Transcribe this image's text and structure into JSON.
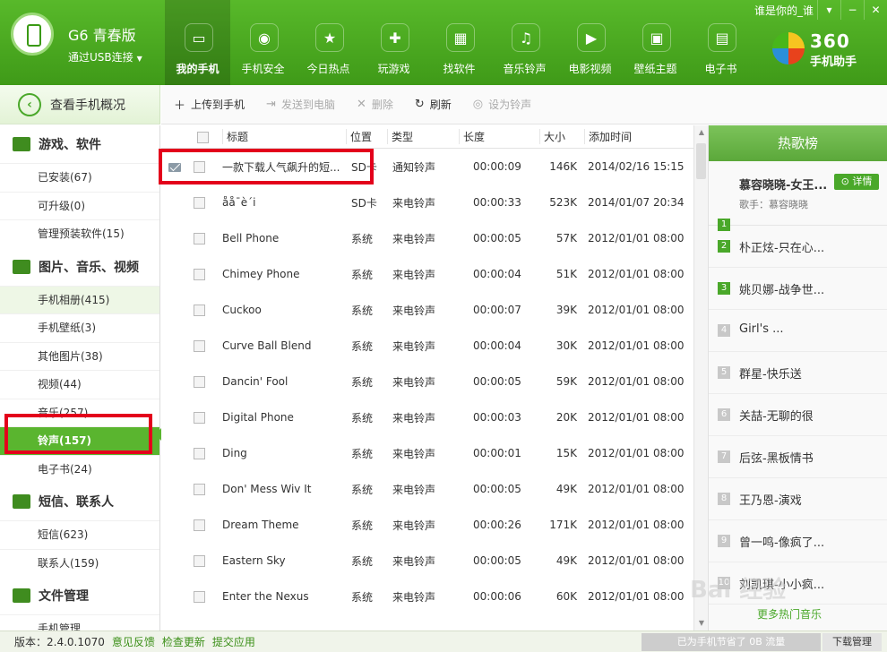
{
  "header": {
    "device_name": "G6 青春版",
    "connection": "通过USB连接",
    "user_label": "谁是你的_谁",
    "brand_num": "360",
    "brand_sub": "手机助手"
  },
  "nav": [
    {
      "label": "我的手机",
      "icon": "phone-icon",
      "glyph": "▭"
    },
    {
      "label": "手机安全",
      "icon": "shield-icon",
      "glyph": "◉"
    },
    {
      "label": "今日热点",
      "icon": "star-news-icon",
      "glyph": "★"
    },
    {
      "label": "玩游戏",
      "icon": "gamepad-icon",
      "glyph": "✚"
    },
    {
      "label": "找软件",
      "icon": "bag-icon",
      "glyph": "▦"
    },
    {
      "label": "音乐铃声",
      "icon": "music-icon",
      "glyph": "♫"
    },
    {
      "label": "电影视频",
      "icon": "film-icon",
      "glyph": "▶"
    },
    {
      "label": "壁纸主题",
      "icon": "picture-icon",
      "glyph": "▣"
    },
    {
      "label": "电子书",
      "icon": "book-icon",
      "glyph": "▤"
    }
  ],
  "overview": {
    "label": "查看手机概况"
  },
  "toolbar": {
    "upload": "上传到手机",
    "send": "发送到电脑",
    "delete": "删除",
    "refresh": "刷新",
    "set_ring": "设为铃声"
  },
  "sidebar": {
    "groups": [
      {
        "title": "游戏、软件",
        "items": [
          "已安装(67)",
          "可升级(0)",
          "管理预装软件(15)"
        ]
      },
      {
        "title": "图片、音乐、视频",
        "items": [
          "手机相册(415)",
          "手机壁纸(3)",
          "其他图片(38)",
          "视频(44)",
          "音乐(257)",
          "铃声(157)",
          "电子书(24)"
        ]
      },
      {
        "title": "短信、联系人",
        "items": [
          "短信(623)",
          "联系人(159)"
        ]
      },
      {
        "title": "文件管理",
        "items": [
          "手机管理"
        ]
      }
    ]
  },
  "table": {
    "headers": [
      "标题",
      "位置",
      "类型",
      "长度",
      "大小",
      "添加时间"
    ],
    "rows": [
      [
        "一款下载人气飙升的短...",
        "SD卡",
        "通知铃声",
        "00:00:09",
        "146K",
        "2014/02/16 15:15"
      ],
      [
        "åå¯è´i",
        "SD卡",
        "来电铃声",
        "00:00:33",
        "523K",
        "2014/01/07 20:34"
      ],
      [
        "Bell Phone",
        "系统",
        "来电铃声",
        "00:00:05",
        "57K",
        "2012/01/01 08:00"
      ],
      [
        "Chimey Phone",
        "系统",
        "来电铃声",
        "00:00:04",
        "51K",
        "2012/01/01 08:00"
      ],
      [
        "Cuckoo",
        "系统",
        "来电铃声",
        "00:00:07",
        "39K",
        "2012/01/01 08:00"
      ],
      [
        "Curve Ball Blend",
        "系统",
        "来电铃声",
        "00:00:04",
        "30K",
        "2012/01/01 08:00"
      ],
      [
        "Dancin' Fool",
        "系统",
        "来电铃声",
        "00:00:05",
        "59K",
        "2012/01/01 08:00"
      ],
      [
        "Digital Phone",
        "系统",
        "来电铃声",
        "00:00:03",
        "20K",
        "2012/01/01 08:00"
      ],
      [
        "Ding",
        "系统",
        "来电铃声",
        "00:00:01",
        "15K",
        "2012/01/01 08:00"
      ],
      [
        "Don' Mess Wiv It",
        "系统",
        "来电铃声",
        "00:00:05",
        "49K",
        "2012/01/01 08:00"
      ],
      [
        "Dream Theme",
        "系统",
        "来电铃声",
        "00:00:26",
        "171K",
        "2012/01/01 08:00"
      ],
      [
        "Eastern Sky",
        "系统",
        "来电铃声",
        "00:00:05",
        "49K",
        "2012/01/01 08:00"
      ],
      [
        "Enter the Nexus",
        "系统",
        "来电铃声",
        "00:00:06",
        "60K",
        "2012/01/01 08:00"
      ]
    ]
  },
  "hotlist": {
    "title": "热歌榜",
    "top": {
      "rank": "1",
      "song": "慕容晓晓-女王...",
      "singer": "歌手：慕容晓晓",
      "detail": "详情"
    },
    "items": [
      {
        "rank": "2",
        "name": "朴正炫-只在心..."
      },
      {
        "rank": "3",
        "name": "姚贝娜-战争世..."
      },
      {
        "rank": "4",
        "name": "Girl's ..."
      },
      {
        "rank": "5",
        "name": "群星-快乐送"
      },
      {
        "rank": "6",
        "name": "关喆-无聊的很"
      },
      {
        "rank": "7",
        "name": "后弦-黑板情书"
      },
      {
        "rank": "8",
        "name": "王乃恩-演戏"
      },
      {
        "rank": "9",
        "name": "曾一鸣-像疯了..."
      },
      {
        "rank": "10",
        "name": "刘凯琪-小小疯..."
      }
    ],
    "more": "更多热门音乐"
  },
  "status": {
    "version": "版本：2.4.0.1070",
    "feedback": "意见反馈",
    "update": "检查更新",
    "submit": "提交应用",
    "save_info": "已为手机节省了 0B 流量",
    "download": "下载管理"
  },
  "watermark": "Bai 经验",
  "colors": {
    "brand_green": "#4aa82a",
    "highlight_red": "#e3001b"
  }
}
